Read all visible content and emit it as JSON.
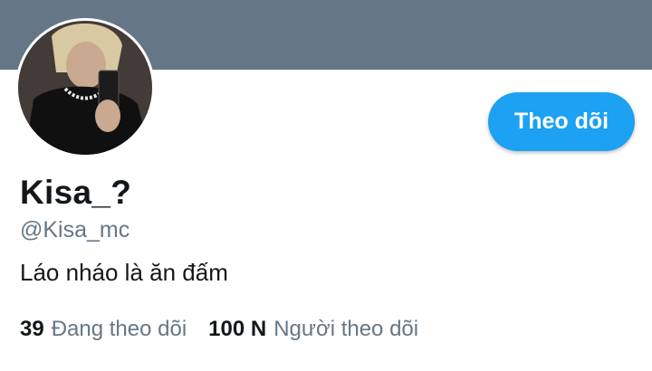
{
  "profile": {
    "display_name": "Kisa_?",
    "handle": "@Kisa_mc",
    "bio": "Láo nháo là ăn đấm",
    "follow_label": "Theo dõi",
    "avatar_icon": "user-avatar-photo"
  },
  "stats": {
    "following_count": "39",
    "following_label": "Đang theo dõi",
    "followers_count": "100 N",
    "followers_label": "Người theo dõi"
  },
  "colors": {
    "banner": "#657786",
    "accent": "#1da1f2",
    "text_primary": "#14171a",
    "text_secondary": "#657786"
  }
}
